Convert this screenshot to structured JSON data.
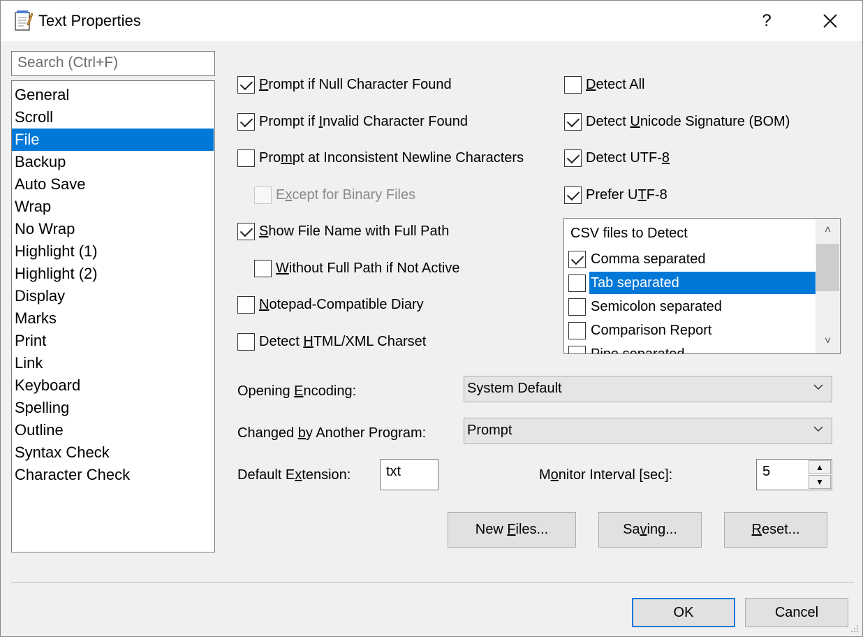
{
  "window": {
    "title": "Text Properties",
    "help": "?",
    "close": "✕"
  },
  "search": {
    "placeholder": "Search (Ctrl+F)"
  },
  "nav": {
    "items": [
      "General",
      "Scroll",
      "File",
      "Backup",
      "Auto Save",
      "Wrap",
      "No Wrap",
      "Highlight (1)",
      "Highlight (2)",
      "Display",
      "Marks",
      "Print",
      "Link",
      "Keyboard",
      "Spelling",
      "Outline",
      "Syntax Check",
      "Character Check"
    ],
    "selected": "File"
  },
  "left_options": {
    "null_char": {
      "pre": "",
      "u": "P",
      "post": "rompt if Null Character Found",
      "checked": true
    },
    "invalid_char": {
      "pre": "Prompt if ",
      "u": "I",
      "post": "nvalid Character Found",
      "checked": true
    },
    "newline": {
      "pre": "Pro",
      "u": "m",
      "post": "pt at Inconsistent Newline Characters",
      "checked": false
    },
    "binary": {
      "pre": "E",
      "u": "x",
      "post": "cept for Binary Files",
      "checked": false
    },
    "full_path": {
      "pre": "",
      "u": "S",
      "post": "how File Name with Full Path",
      "checked": true
    },
    "not_active": {
      "pre": "",
      "u": "W",
      "post": "ithout Full Path if Not Active",
      "checked": false
    },
    "diary": {
      "pre": "",
      "u": "N",
      "post": "otepad-Compatible Diary",
      "checked": false
    },
    "charset": {
      "pre": "Detect ",
      "u": "H",
      "post": "TML/XML Charset",
      "checked": false
    }
  },
  "right_options": {
    "detect_all": {
      "pre": "",
      "u": "D",
      "post": "etect All",
      "checked": false
    },
    "bom": {
      "pre": "Detect ",
      "u": "U",
      "post": "nicode Signature (BOM)",
      "checked": true
    },
    "utf8": {
      "pre": "Detect UTF-",
      "u": "8",
      "post": "",
      "checked": true
    },
    "prefer_utf8": {
      "pre": "Prefer U",
      "u": "T",
      "post": "F-8",
      "checked": true
    }
  },
  "csv": {
    "header": "CSV files to Detect",
    "items": [
      {
        "label": "Comma separated",
        "checked": true
      },
      {
        "label": "Tab separated",
        "checked": false
      },
      {
        "label": "Semicolon separated",
        "checked": false
      },
      {
        "label": "Comparison Report",
        "checked": false
      },
      {
        "label": "Pipe separated",
        "checked": false
      }
    ],
    "selected_index": 1
  },
  "opening_encoding": {
    "pre": "Opening ",
    "u": "E",
    "post": "ncoding:",
    "value": "System Default"
  },
  "changed_by": {
    "pre": "Changed ",
    "u": "b",
    "post": "y Another Program:",
    "value": "Prompt"
  },
  "default_extension": {
    "pre": "Default E",
    "u": "x",
    "post": "tension:",
    "value": "txt"
  },
  "monitor_interval": {
    "pre": "M",
    "u": "o",
    "post": "nitor Interval [sec]:",
    "value": "5"
  },
  "buttons": {
    "new_files": {
      "pre": "New ",
      "u": "F",
      "post": "iles..."
    },
    "saving": {
      "pre": "Sa",
      "u": "v",
      "post": "ing..."
    },
    "reset": {
      "pre": "",
      "u": "R",
      "post": "eset..."
    },
    "ok": "OK",
    "cancel": "Cancel"
  },
  "colors": {
    "selection": "#0078d7",
    "dialog_bg": "#f0f0f0"
  }
}
